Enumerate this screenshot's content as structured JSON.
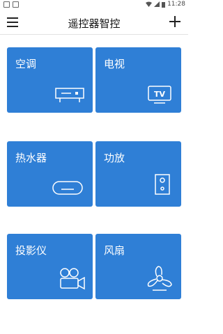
{
  "status_bar": {
    "time": "11:28"
  },
  "header": {
    "title": "遥控器智控"
  },
  "devices": [
    {
      "label": "空调",
      "icon": "air-conditioner-icon"
    },
    {
      "label": "电视",
      "icon": "tv-icon",
      "icon_text": "TV"
    },
    {
      "label": "热水器",
      "icon": "water-heater-icon"
    },
    {
      "label": "功放",
      "icon": "speaker-icon"
    },
    {
      "label": "投影仪",
      "icon": "projector-camera-icon"
    },
    {
      "label": "风扇",
      "icon": "fan-icon"
    }
  ],
  "colors": {
    "tile": "#2f7fd6",
    "background": "#ffffff"
  }
}
